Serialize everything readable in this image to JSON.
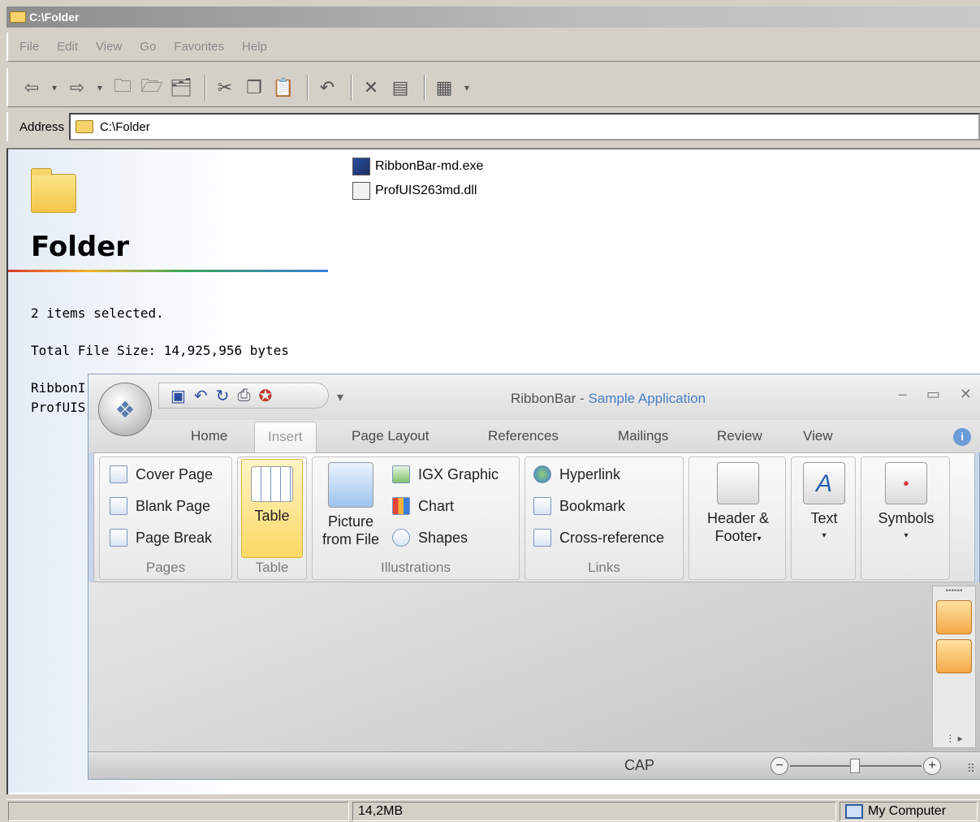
{
  "window": {
    "title": "C:\\Folder"
  },
  "menu": [
    "File",
    "Edit",
    "View",
    "Go",
    "Favorites",
    "Help"
  ],
  "toolbar_icons": [
    "back-arrow",
    "forward-arrow",
    "up-folder",
    "new-folder",
    "folder-options",
    "cut",
    "copy",
    "paste",
    "undo",
    "delete",
    "properties",
    "views"
  ],
  "address": {
    "label": "Address",
    "value": "C:\\Folder"
  },
  "left_panel": {
    "folder_name": "Folder",
    "selected": "2 items selected.",
    "size": "Total File Size: 14,925,956 bytes",
    "list": [
      "RibbonI",
      "ProfUIS"
    ]
  },
  "files": [
    "RibbonBar-md.exe",
    "ProfUIS263md.dll"
  ],
  "ribbon_window": {
    "title_app": "RibbonBar",
    "title_sep": " - ",
    "title_doc": "Sample Application",
    "tabs": [
      "Home",
      "Insert",
      "Page Layout",
      "References",
      "Mailings",
      "Review",
      "View"
    ],
    "groups": {
      "pages": {
        "label": "Pages",
        "items": [
          "Cover Page",
          "Blank Page",
          "Page Break"
        ]
      },
      "table": {
        "label": "Table",
        "button": "Table"
      },
      "illustrations": {
        "label": "Illustrations",
        "picture1": "Picture",
        "picture2": "from File",
        "items": [
          "IGX Graphic",
          "Chart",
          "Shapes"
        ]
      },
      "links": {
        "label": "Links",
        "items": [
          "Hyperlink",
          "Bookmark",
          "Cross-reference"
        ]
      },
      "header": {
        "l1": "Header &",
        "l2": "Footer"
      },
      "text": {
        "label": "Text"
      },
      "symbols": {
        "label": "Symbols"
      }
    },
    "status": {
      "cap": "CAP"
    }
  },
  "statusbar": {
    "size": "14,2MB",
    "zone": "My Computer"
  },
  "colors": {
    "accent": "#4a7dc0",
    "table_highlight": "#fbd765"
  }
}
